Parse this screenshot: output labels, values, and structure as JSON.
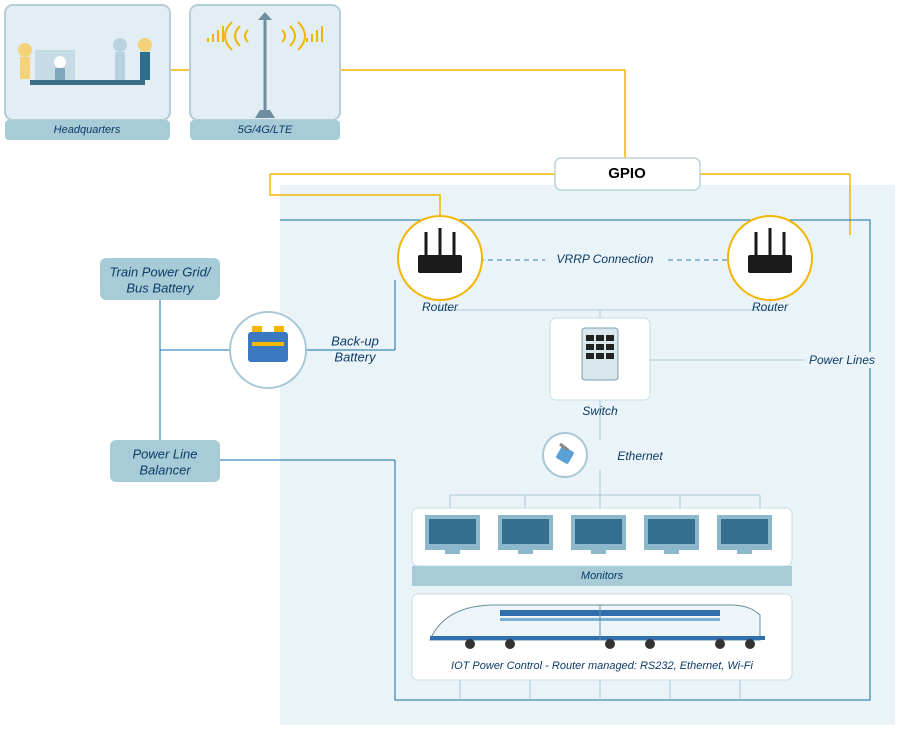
{
  "headquarters_label": "Headquarters",
  "cell_label": "5G/4G/LTE",
  "gpio_label": "GPIO",
  "train_power_label_line1": "Train Power Grid/",
  "train_power_label_line2": "Bus Battery",
  "backup_battery_label_line1": "Back-up",
  "backup_battery_label_line2": "Battery",
  "power_line_balancer_label_line1": "Power Line",
  "power_line_balancer_label_line2": "Balancer",
  "router_label": "Router",
  "vrrp_label": "VRRP Connection",
  "switch_label": "Switch",
  "ethernet_label": "Ethernet",
  "power_lines_label": "Power Lines",
  "monitors_label": "Monitors",
  "iot_label": "IOT Power Control - Router managed: RS232, Ethernet, Wi-Fi"
}
